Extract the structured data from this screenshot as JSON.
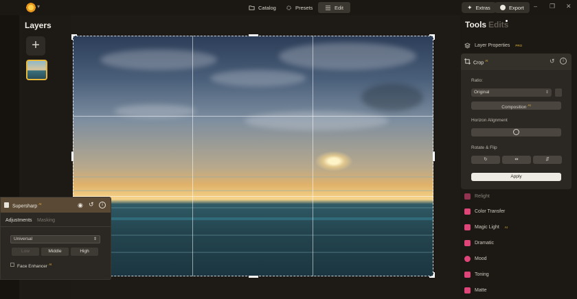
{
  "topbar": {
    "catalog": "Catalog",
    "presets": "Presets",
    "edit": "Edit",
    "extras": "Extras",
    "export": "Export",
    "minimize": "–",
    "maximize": "❐",
    "close": "✕"
  },
  "layers": {
    "title": "Layers",
    "add": "+"
  },
  "tools": {
    "title": "Tools",
    "edits": "Edits",
    "layer_properties": "Layer Properties",
    "layer_properties_badge": "PRO",
    "crop": {
      "title": "Crop",
      "badge": "AI",
      "ratio_label": "Ratio:",
      "ratio_value": "Original",
      "composition": "Composition",
      "composition_badge": "AI",
      "horizon_label": "Horizon Alignment",
      "rotate_label": "Rotate & Flip",
      "apply": "Apply"
    },
    "items": [
      {
        "label": "Color Transfer",
        "badge": ""
      },
      {
        "label": "Magic Light",
        "badge": "AI"
      },
      {
        "label": "Dramatic",
        "badge": ""
      },
      {
        "label": "Mood",
        "badge": ""
      },
      {
        "label": "Toning",
        "badge": ""
      },
      {
        "label": "Matte",
        "badge": ""
      }
    ],
    "partial_label": "Relight"
  },
  "supersharp": {
    "title": "Supersharp",
    "badge": "AI",
    "tab_adjustments": "Adjustments",
    "tab_masking": "Masking",
    "mode": "Universal",
    "low": "Low",
    "middle": "Middle",
    "high": "High",
    "face_enhancer": "Face Enhancer",
    "face_enhancer_badge": "AI"
  },
  "colors": {
    "accent": "#e8b83a",
    "tool_icon": "#e0457a"
  }
}
